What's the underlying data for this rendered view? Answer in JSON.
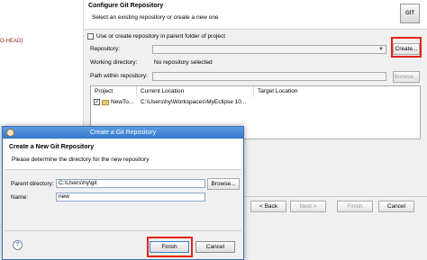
{
  "left_pane": {
    "head_text": "O-HEAD]"
  },
  "wizard": {
    "title": "Configure Git Repository",
    "subtitle": "Select an existing repository or create a new one",
    "logo": "GIT",
    "parent_checkbox_label": "Use or create repository in parent folder of project",
    "parent_checked": false,
    "repository_label": "Repository:",
    "working_dir_label": "Working directory:",
    "working_dir_value": "No repository selected",
    "path_label": "Path within repository:",
    "create_button": "Create...",
    "browse_button": "Browse...",
    "table": {
      "headers": [
        "Project",
        "Current Location",
        "Target Location"
      ],
      "rows": [
        {
          "checked": true,
          "project": "NewTo...",
          "current": "C:\\Users\\hy\\Workspaces\\MyEclipse 10...",
          "target": ""
        }
      ]
    },
    "nav": {
      "back": "< Back",
      "next": "Next >",
      "finish": "Finish",
      "cancel": "Cancel"
    }
  },
  "dialog": {
    "window_title": "Create a Git Repository",
    "title": "Create a New Git Repository",
    "subtitle": "Please determine the directory for the new repository",
    "parent_dir_label": "Parent directory:",
    "parent_dir_value": "C:\\Users\\hy\\git",
    "browse_button": "Browse...",
    "name_label": "Name:",
    "name_value": "new",
    "help": "?",
    "finish_button": "Finish",
    "cancel_button": "Cancel"
  },
  "colors": {
    "highlight": "#e2231a",
    "titlebar": "#3478cc"
  }
}
